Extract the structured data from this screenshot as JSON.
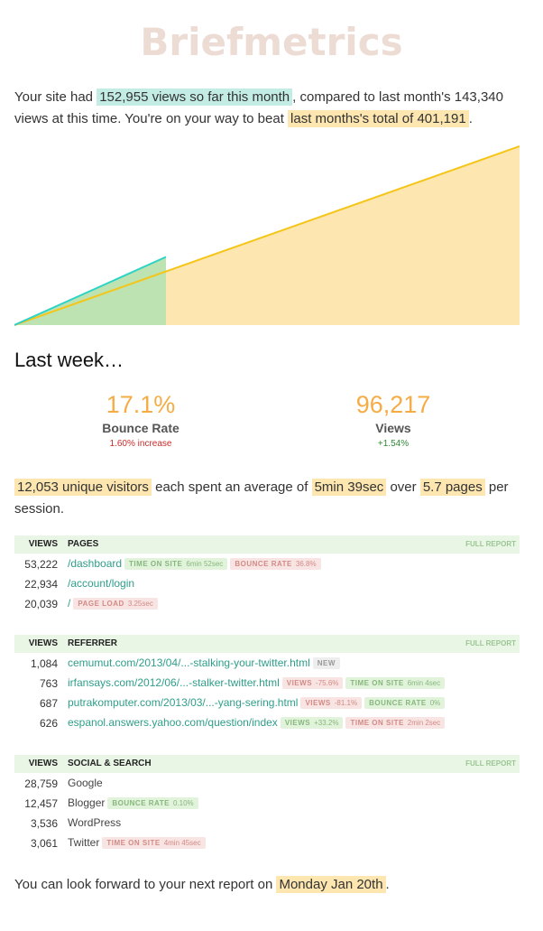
{
  "brand": "Briefmetrics",
  "intro": {
    "p1": "Your site had ",
    "h1": "152,955 views so far this month",
    "p2": ", compared to last month's 143,340 views at this time. You're on your way to beat ",
    "h2": "last months's total of 401,191",
    "p3": "."
  },
  "chart_data": {
    "type": "area",
    "x": [
      1,
      31
    ],
    "series": [
      {
        "values": [
          0,
          401191
        ],
        "color": "#f5c518",
        "fill": "#fde6b0"
      },
      {
        "values": [
          0,
          152955
        ],
        "color": "#2ed3c5",
        "fill": "#bde3b2",
        "x_end": 10
      }
    ],
    "ylim": [
      0,
      401191
    ]
  },
  "last_week": {
    "title": "Last week…",
    "stats": [
      {
        "value": "17.1%",
        "label": "Bounce Rate",
        "change": "1.60% increase"
      },
      {
        "value": "96,217",
        "label": "Views",
        "change": "+1.54%"
      }
    ]
  },
  "summary": {
    "h1": "12,053 unique visitors",
    "t1": " each spent an average of ",
    "h2": "5min 39sec",
    "t2": " over ",
    "h3": "5.7 pages",
    "t3": " per session."
  },
  "pages": {
    "headers": [
      "VIEWS",
      "PAGES",
      "FULL REPORT"
    ],
    "rows": [
      {
        "views": "53,222",
        "label": "/dashboard",
        "tags": [
          {
            "name": "TIME ON SITE",
            "value": "6min 52sec",
            "tone": "green"
          },
          {
            "name": "BOUNCE RATE",
            "value": "36.8%",
            "tone": "pink"
          }
        ]
      },
      {
        "views": "22,934",
        "label": "/account/login",
        "tags": []
      },
      {
        "views": "20,039",
        "label": "/",
        "tags": [
          {
            "name": "PAGE LOAD",
            "value": "3.25sec",
            "tone": "pink"
          }
        ]
      }
    ]
  },
  "referrer": {
    "headers": [
      "VIEWS",
      "REFERRER",
      "FULL REPORT"
    ],
    "rows": [
      {
        "views": "1,084",
        "label": "cemumut.com/2013/04/...-stalking-your-twitter.html",
        "tags": [
          {
            "name": "NEW",
            "value": "",
            "tone": "gray"
          }
        ]
      },
      {
        "views": "763",
        "label": "irfansays.com/2012/06/...-stalker-twitter.html",
        "tags": [
          {
            "name": "VIEWS",
            "value": "-75.6%",
            "tone": "pink"
          },
          {
            "name": "TIME ON SITE",
            "value": "6min 4sec",
            "tone": "green"
          }
        ]
      },
      {
        "views": "687",
        "label": "putrakomputer.com/2013/03/...-yang-sering.html",
        "tags": [
          {
            "name": "VIEWS",
            "value": "-81.1%",
            "tone": "pink"
          },
          {
            "name": "BOUNCE RATE",
            "value": "0%",
            "tone": "green"
          }
        ]
      },
      {
        "views": "626",
        "label": "espanol.answers.yahoo.com/question/index",
        "tags": [
          {
            "name": "VIEWS",
            "value": "+33.2%",
            "tone": "green"
          },
          {
            "name": "TIME ON SITE",
            "value": "2min 2sec",
            "tone": "pink"
          }
        ]
      }
    ]
  },
  "social": {
    "headers": [
      "VIEWS",
      "SOCIAL & SEARCH",
      "FULL REPORT"
    ],
    "rows": [
      {
        "views": "28,759",
        "label": "Google",
        "tags": []
      },
      {
        "views": "12,457",
        "label": "Blogger",
        "tags": [
          {
            "name": "BOUNCE RATE",
            "value": "0.10%",
            "tone": "green"
          }
        ]
      },
      {
        "views": "3,536",
        "label": "WordPress",
        "tags": []
      },
      {
        "views": "3,061",
        "label": "Twitter",
        "tags": [
          {
            "name": "TIME ON SITE",
            "value": "4min 45sec",
            "tone": "pink"
          }
        ]
      }
    ]
  },
  "footer": {
    "t1": "You can look forward to your next report on ",
    "h1": "Monday Jan 20th",
    "t2": "."
  }
}
